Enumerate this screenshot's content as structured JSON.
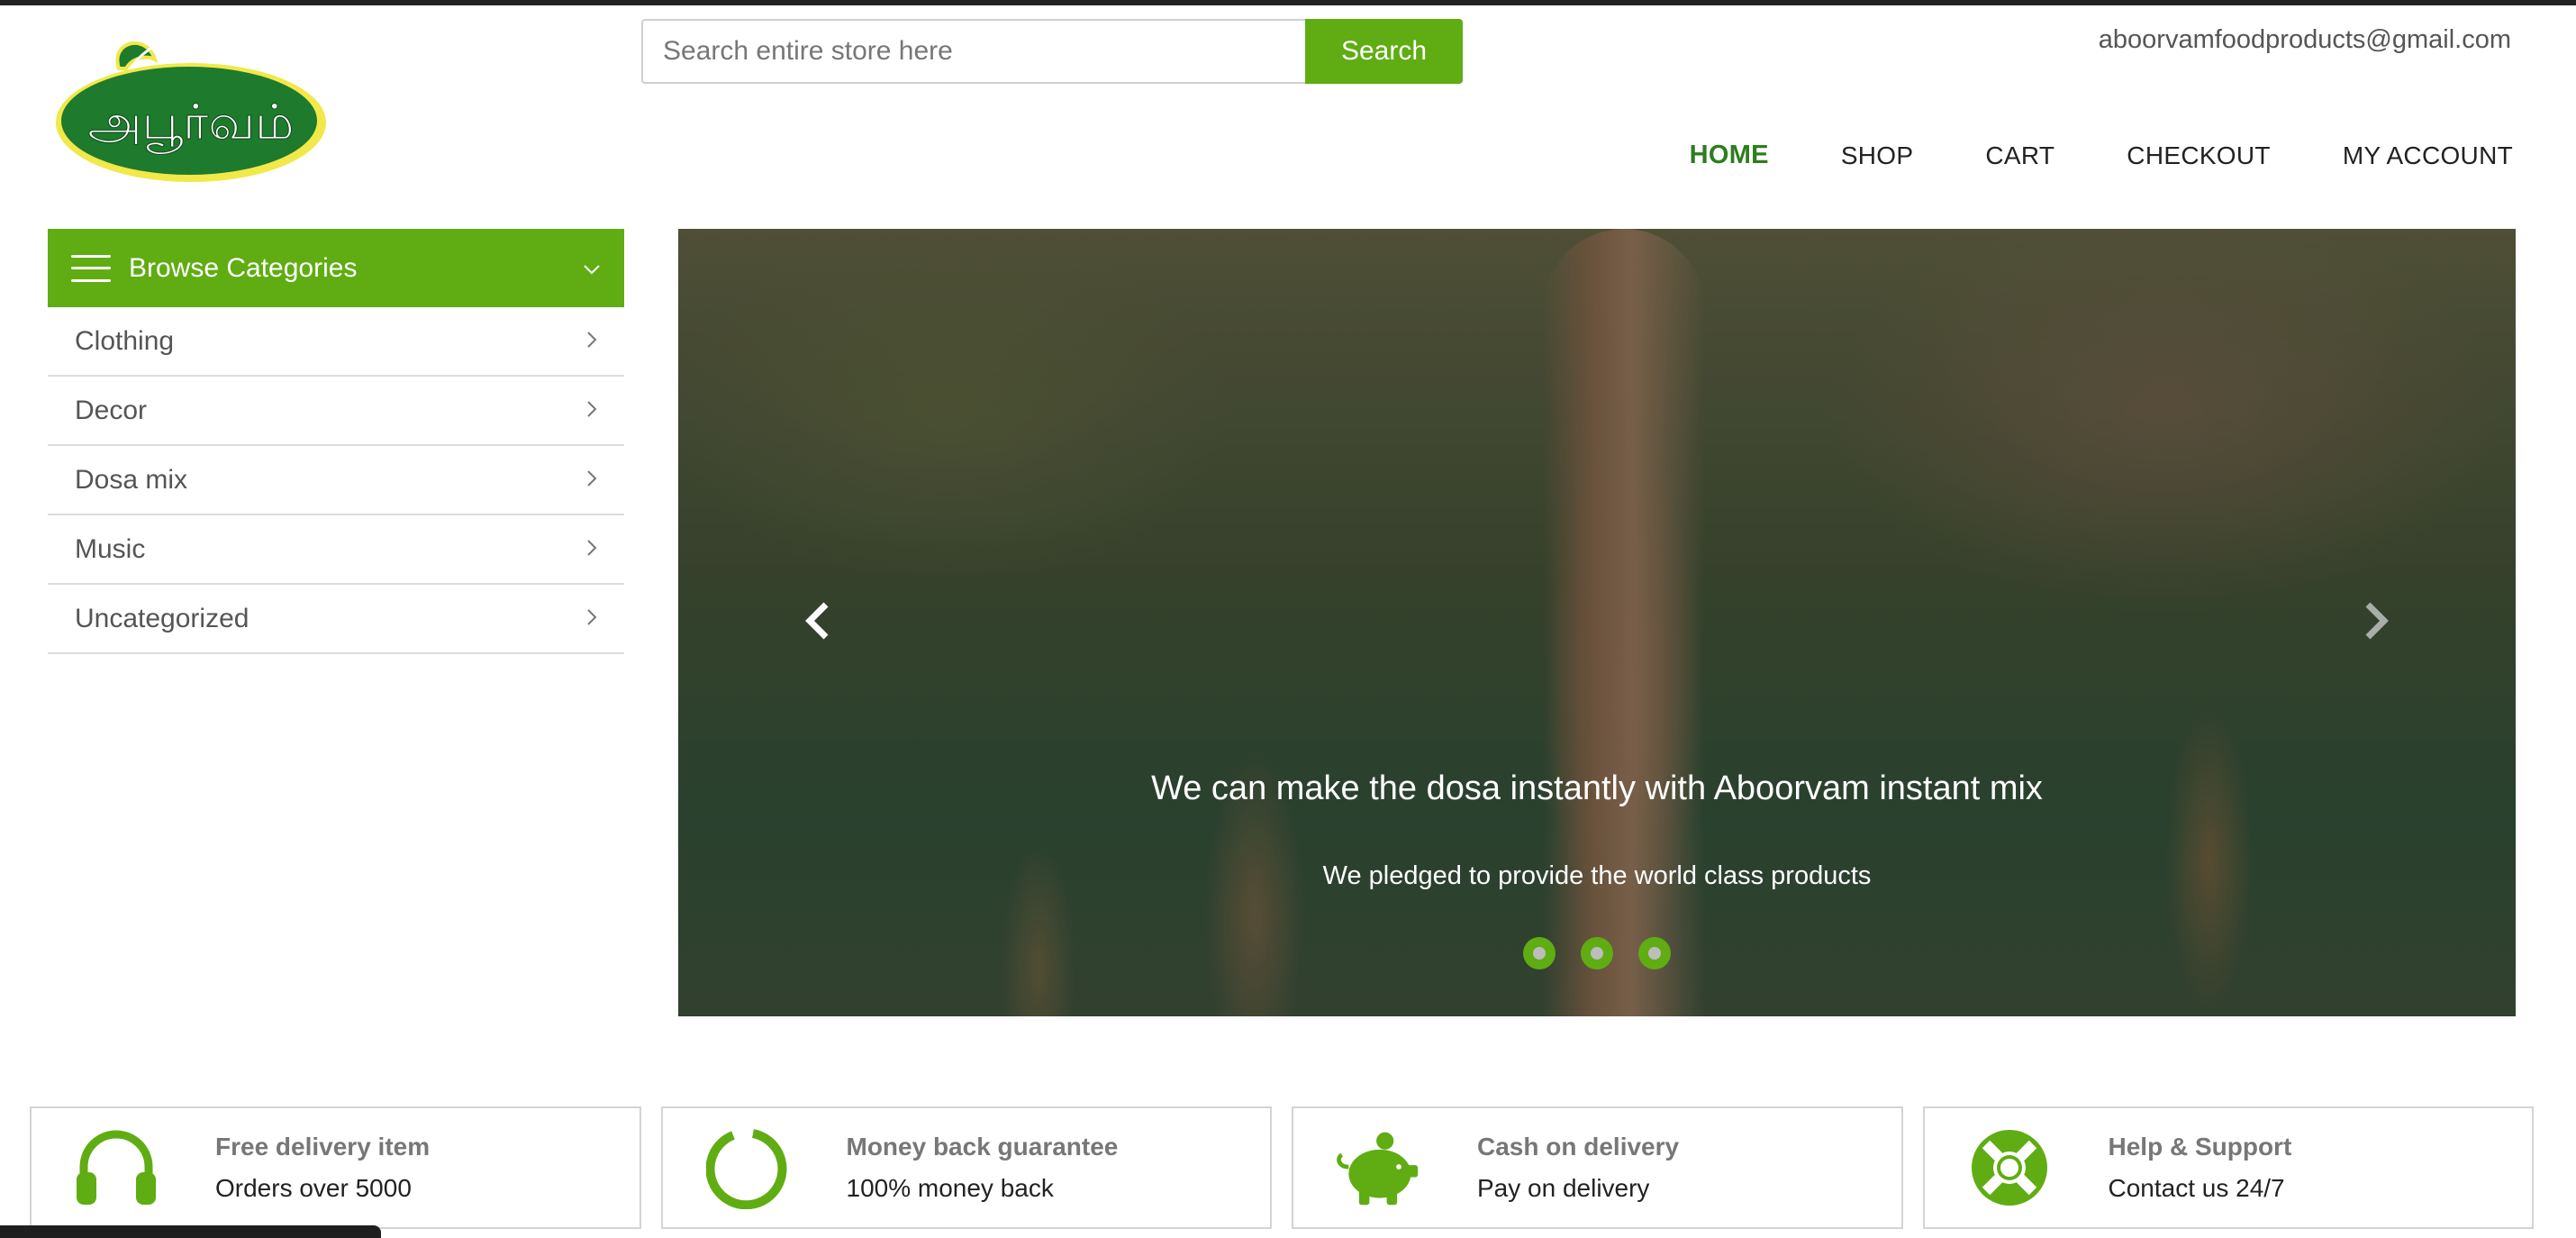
{
  "brand": {
    "logo_alt": "Aboorvam logo",
    "logo_text": "அபூர்வம்"
  },
  "search": {
    "placeholder": "Search entire store here",
    "button_label": "Search"
  },
  "header": {
    "email": "aboorvamfoodproducts@gmail.com"
  },
  "nav": {
    "items": [
      {
        "label": "HOME",
        "active": true
      },
      {
        "label": "SHOP"
      },
      {
        "label": "CART"
      },
      {
        "label": "CHECKOUT"
      },
      {
        "label": "MY ACCOUNT"
      }
    ]
  },
  "sidebar": {
    "title": "Browse Categories",
    "items": [
      {
        "label": "Clothing"
      },
      {
        "label": "Decor"
      },
      {
        "label": "Dosa mix"
      },
      {
        "label": "Music"
      },
      {
        "label": "Uncategorized"
      }
    ]
  },
  "hero": {
    "title": "We can make the dosa instantly with Aboorvam instant mix",
    "subtitle": "We pledged to provide the world class products",
    "slide_count": 3
  },
  "features": [
    {
      "title": "Free delivery item",
      "subtitle": "Orders over 5000",
      "icon": "headphones-icon"
    },
    {
      "title": "Money back guarantee",
      "subtitle": "100% money back",
      "icon": "refresh-icon"
    },
    {
      "title": "Cash on delivery",
      "subtitle": "Pay on delivery",
      "icon": "piggy-bank-icon"
    },
    {
      "title": "Help & Support",
      "subtitle": "Contact us 24/7",
      "icon": "lifebuoy-icon"
    }
  ],
  "colors": {
    "accent": "#5fad12",
    "nav_active": "#2e7d1e",
    "logo_green": "#1e7a2c"
  }
}
